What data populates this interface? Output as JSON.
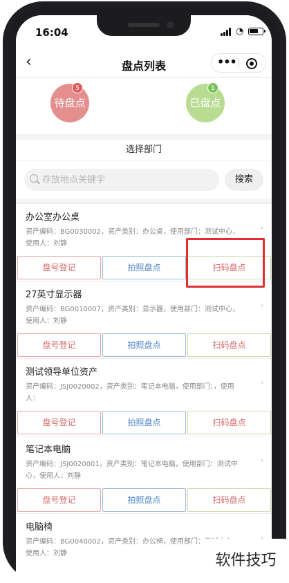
{
  "status_bar": {
    "time": "16:04"
  },
  "nav": {
    "title": "盘点列表",
    "more_glyph": "•••"
  },
  "summary": {
    "pending": {
      "label": "待盘点",
      "count": "5"
    },
    "done": {
      "label": "已盘点",
      "count": "1"
    }
  },
  "department": {
    "label": "选择部门"
  },
  "search": {
    "placeholder": "存放地点关键字",
    "value": "",
    "button_label": "搜索"
  },
  "actions": {
    "register": "盘号登记",
    "photo": "拍照盘点",
    "scan": "扫码盘点"
  },
  "assets": [
    {
      "name": "办公室办公桌",
      "line1": "资产编码：BG0030002，资产类别：办公桌，使用部门：测试中心，",
      "line2": "使用人：刘静"
    },
    {
      "name": "27英寸显示器",
      "line1": "资产编码：BG0010007，资产类别：显示器，使用部门：测试中心，",
      "line2": "使用人：刘静"
    },
    {
      "name": "测试领导单位资产",
      "line1": "资产编码：JSJ0020002，资产类别：笔记本电脑，使用部门：，使用",
      "line2": "人："
    },
    {
      "name": "笔记本电脑",
      "line1": "资产编码：JSJ0020001，资产类别：笔记本电脑，使用部门：测试中",
      "line2": "心，使用人：刘静"
    },
    {
      "name": "电脑椅",
      "line1": "资产编码：BG0040002，资产类别：办公椅，使用部门：测试中心，",
      "line2": "使用人：刘静"
    }
  ],
  "watermark": "软件技巧",
  "colors": {
    "pending": "#e58e8e",
    "done": "#b8dd92",
    "highlight": "#e02f2f",
    "photo_text": "#4f86c6",
    "register_text": "#d86a6a"
  }
}
